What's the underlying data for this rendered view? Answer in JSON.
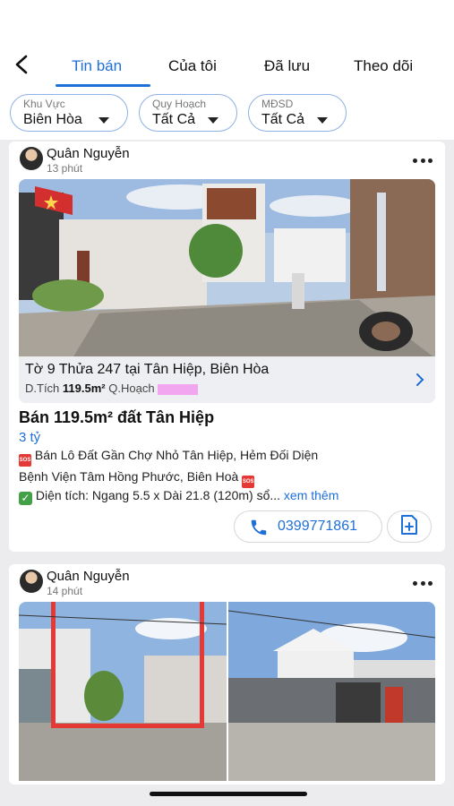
{
  "tabs": [
    {
      "label": "Tin bán",
      "active": true
    },
    {
      "label": "Của tôi"
    },
    {
      "label": "Đã lưu"
    },
    {
      "label": "Theo dõi"
    }
  ],
  "filters": [
    {
      "label": "Khu Vực",
      "value": "Biên Hòa"
    },
    {
      "label": "Quy Hoạch",
      "value": "Tất Cả"
    },
    {
      "label": "MĐSD",
      "value": "Tất Cả"
    }
  ],
  "posts": [
    {
      "author": "Quân Nguyễn",
      "time": "13 phút",
      "caption": {
        "title": "Tờ 9 Thửa 247 tại Tân Hiệp, Biên Hòa",
        "area_label": "D.Tích",
        "area_value": "119.5m²",
        "planning_label": "Q.Hoạch"
      },
      "title": "Bán 119.5m² đất Tân Hiệp",
      "price": "3 tỷ",
      "desc_line1": "Bán Lô Đất Gần Chợ Nhỏ Tân Hiệp, Hẻm Đối Diện",
      "desc_line2": "Bệnh Viện Tâm Hồng Phước, Biên Hoà",
      "desc_line3": "Diện tích: Ngang 5.5 x Dài 21.8 (120m) sổ...",
      "see_more": "xem thêm",
      "phone": "0399771861"
    },
    {
      "author": "Quân Nguyễn",
      "time": "14 phút"
    }
  ],
  "colors": {
    "accent": "#1f6fd8",
    "background": "#ececef",
    "pill_border": "#8fb1e6"
  },
  "icons": [
    "back-arrow-icon",
    "caret-down-icon",
    "more-dots-icon",
    "chevron-right-icon",
    "phone-icon",
    "add-document-icon"
  ]
}
